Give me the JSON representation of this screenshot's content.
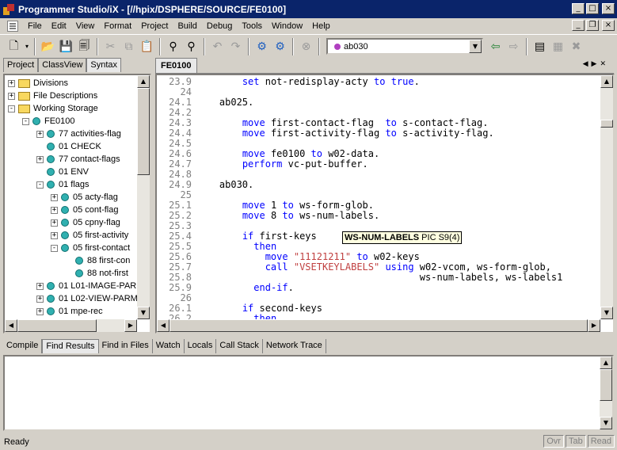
{
  "window": {
    "title": "Programmer Studio/iX - [//hpix/DSPHERE/SOURCE/FE0100]"
  },
  "menu": [
    "File",
    "Edit",
    "View",
    "Format",
    "Project",
    "Build",
    "Debug",
    "Tools",
    "Window",
    "Help"
  ],
  "toolbar": {
    "combo_value": "ab030",
    "icons": [
      "new-icon",
      "open-icon",
      "save-icon",
      "save-all-icon",
      "cut-icon",
      "copy-icon",
      "paste-icon",
      "find-icon",
      "find-replace-icon",
      "undo-icon",
      "redo-icon",
      "build-icon",
      "rebuild-icon",
      "stop-icon",
      "back-icon",
      "forward-icon",
      "toolbox-icon",
      "checklist-icon",
      "delete-icon"
    ]
  },
  "left_tabs": [
    "Project",
    "ClassView",
    "Syntax"
  ],
  "tree": [
    {
      "label": "Divisions",
      "kind": "folder",
      "expander": "+"
    },
    {
      "label": "File Descriptions",
      "kind": "folder",
      "expander": "+"
    },
    {
      "label": "Working Storage",
      "kind": "folder",
      "expander": "-"
    },
    {
      "label": "FE0100",
      "kind": "ball",
      "expander": "-"
    },
    {
      "label": "77 activities-flag",
      "kind": "ball",
      "expander": "+"
    },
    {
      "label": "01 CHECK",
      "kind": "ball",
      "expander": ""
    },
    {
      "label": "77 contact-flags",
      "kind": "ball",
      "expander": "+"
    },
    {
      "label": "01 ENV",
      "kind": "ball",
      "expander": ""
    },
    {
      "label": "01 flags",
      "kind": "ball",
      "expander": "-"
    },
    {
      "label": "05 acty-flag",
      "kind": "ball",
      "expander": "+"
    },
    {
      "label": "05 cont-flag",
      "kind": "ball",
      "expander": "+"
    },
    {
      "label": "05 cpny-flag",
      "kind": "ball",
      "expander": "+"
    },
    {
      "label": "05 first-activity",
      "kind": "ball",
      "expander": "+"
    },
    {
      "label": "05 first-contact",
      "kind": "ball",
      "expander": "-"
    },
    {
      "label": "88 first-con",
      "kind": "ball",
      "expander": ""
    },
    {
      "label": "88 not-first",
      "kind": "ball",
      "expander": ""
    },
    {
      "label": "01 L01-IMAGE-PAR",
      "kind": "ball",
      "expander": "+"
    },
    {
      "label": "01 L02-VIEW-PARM",
      "kind": "ball",
      "expander": "+"
    },
    {
      "label": "01 mpe-rec",
      "kind": "ball",
      "expander": "+"
    }
  ],
  "editor_tab": "FE0100",
  "code": [
    {
      "n": "23.9",
      "t": [
        [
          "    ",
          ""
        ],
        [
          "set",
          "kw"
        ],
        [
          " not-redisplay-acty ",
          ""
        ],
        [
          "to",
          "kw"
        ],
        [
          " ",
          ""
        ],
        [
          "true",
          "kw"
        ],
        [
          ".",
          ""
        ]
      ]
    },
    {
      "n": "24",
      "t": []
    },
    {
      "n": "24.1",
      "t": [
        [
          "ab025.",
          ""
        ]
      ]
    },
    {
      "n": "24.2",
      "t": []
    },
    {
      "n": "24.3",
      "t": [
        [
          "    ",
          ""
        ],
        [
          "move",
          "kw"
        ],
        [
          " first-contact-flag  ",
          ""
        ],
        [
          "to",
          "kw"
        ],
        [
          " s-contact-flag.",
          ""
        ]
      ]
    },
    {
      "n": "24.4",
      "t": [
        [
          "    ",
          ""
        ],
        [
          "move",
          "kw"
        ],
        [
          " first-activity-flag ",
          ""
        ],
        [
          "to",
          "kw"
        ],
        [
          " s-activity-flag.",
          ""
        ]
      ]
    },
    {
      "n": "24.5",
      "t": []
    },
    {
      "n": "24.6",
      "t": [
        [
          "    ",
          ""
        ],
        [
          "move",
          "kw"
        ],
        [
          " fe0100 ",
          ""
        ],
        [
          "to",
          "kw"
        ],
        [
          " w02-data.",
          ""
        ]
      ]
    },
    {
      "n": "24.7",
      "t": [
        [
          "    ",
          ""
        ],
        [
          "perform",
          "kw"
        ],
        [
          " vc-put-buffer.",
          ""
        ]
      ]
    },
    {
      "n": "24.8",
      "t": []
    },
    {
      "n": "24.9",
      "t": [
        [
          "ab030.",
          ""
        ]
      ]
    },
    {
      "n": "25",
      "t": []
    },
    {
      "n": "25.1",
      "t": [
        [
          "    ",
          ""
        ],
        [
          "move",
          "kw"
        ],
        [
          " 1 ",
          ""
        ],
        [
          "to",
          "kw"
        ],
        [
          " ws-form-glob.",
          ""
        ]
      ]
    },
    {
      "n": "25.2",
      "t": [
        [
          "    ",
          ""
        ],
        [
          "move",
          "kw"
        ],
        [
          " 8 ",
          ""
        ],
        [
          "to",
          "kw"
        ],
        [
          " ws-num-labels.",
          ""
        ]
      ]
    },
    {
      "n": "25.3",
      "t": []
    },
    {
      "n": "25.4",
      "t": [
        [
          "    ",
          ""
        ],
        [
          "if",
          "kw"
        ],
        [
          " first-keys",
          ""
        ]
      ]
    },
    {
      "n": "25.5",
      "t": [
        [
          "      ",
          ""
        ],
        [
          "then",
          "kw"
        ]
      ]
    },
    {
      "n": "25.6",
      "t": [
        [
          "        ",
          ""
        ],
        [
          "move",
          "kw"
        ],
        [
          " ",
          ""
        ],
        [
          "\"11121211\"",
          "str"
        ],
        [
          " ",
          ""
        ],
        [
          "to",
          "kw"
        ],
        [
          " w02-keys",
          ""
        ]
      ]
    },
    {
      "n": "25.7",
      "t": [
        [
          "        ",
          ""
        ],
        [
          "call",
          "kw"
        ],
        [
          " ",
          ""
        ],
        [
          "\"VSETKEYLABELS\"",
          "str"
        ],
        [
          " ",
          ""
        ],
        [
          "using",
          "kw"
        ],
        [
          " w02-vcom, ws-form-glob,",
          ""
        ]
      ]
    },
    {
      "n": "25.8",
      "t": [
        [
          "                                   ws-num-labels, ws-labels1",
          ""
        ]
      ]
    },
    {
      "n": "25.9",
      "t": [
        [
          "      ",
          ""
        ],
        [
          "end-if",
          "kw"
        ],
        [
          ".",
          ""
        ]
      ]
    },
    {
      "n": "26",
      "t": []
    },
    {
      "n": "26.1",
      "t": [
        [
          "    ",
          ""
        ],
        [
          "if",
          "kw"
        ],
        [
          " second-keys",
          ""
        ]
      ]
    },
    {
      "n": "26.2",
      "t": [
        [
          "      ",
          ""
        ],
        [
          "then",
          "kw"
        ]
      ]
    }
  ],
  "tooltip": {
    "name": "WS-NUM-LABELS",
    "pic": "PIC S9(4)"
  },
  "bottom_tabs": [
    "Compile",
    "Find Results",
    "Find in Files",
    "Watch",
    "Locals",
    "Call Stack",
    "Network Trace"
  ],
  "status": {
    "text": "Ready",
    "panes": [
      "Ovr",
      "Tab",
      "Read"
    ]
  }
}
